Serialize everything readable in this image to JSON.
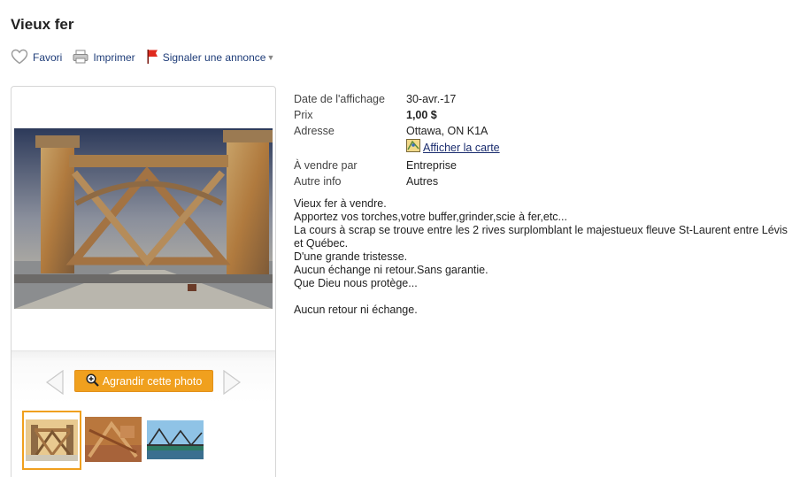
{
  "listing": {
    "title": "Vieux fer"
  },
  "actions": {
    "favorite": "Favori",
    "print": "Imprimer",
    "report": "Signaler une annonce"
  },
  "gallery": {
    "enlarge_label": "Agrandir cette photo"
  },
  "details": {
    "date_label": "Date de l'affichage",
    "date_value": "30-avr.-17",
    "price_label": "Prix",
    "price_value": "1,00 $",
    "address_label": "Adresse",
    "address_value": "Ottawa, ON K1A",
    "map_link": "Afficher la carte",
    "seller_label": "À vendre par",
    "seller_value": "Entreprise",
    "other_label": "Autre info",
    "other_value": "Autres"
  },
  "description": {
    "lines": [
      "Vieux fer à vendre.",
      "Apportez vos torches,votre buffer,grinder,scie à fer,etc...",
      "La cours à scrap se trouve entre les 2 rives surplomblant le majestueux fleuve St-Laurent entre Lévis et Québec.",
      "D'une grande tristesse.",
      "Aucun échange ni retour.Sans garantie.",
      "Que Dieu nous protège..."
    ],
    "footer": "Aucun retour ni échange."
  },
  "colors": {
    "accent": "#f0a01e",
    "link": "#1a2c6e"
  }
}
